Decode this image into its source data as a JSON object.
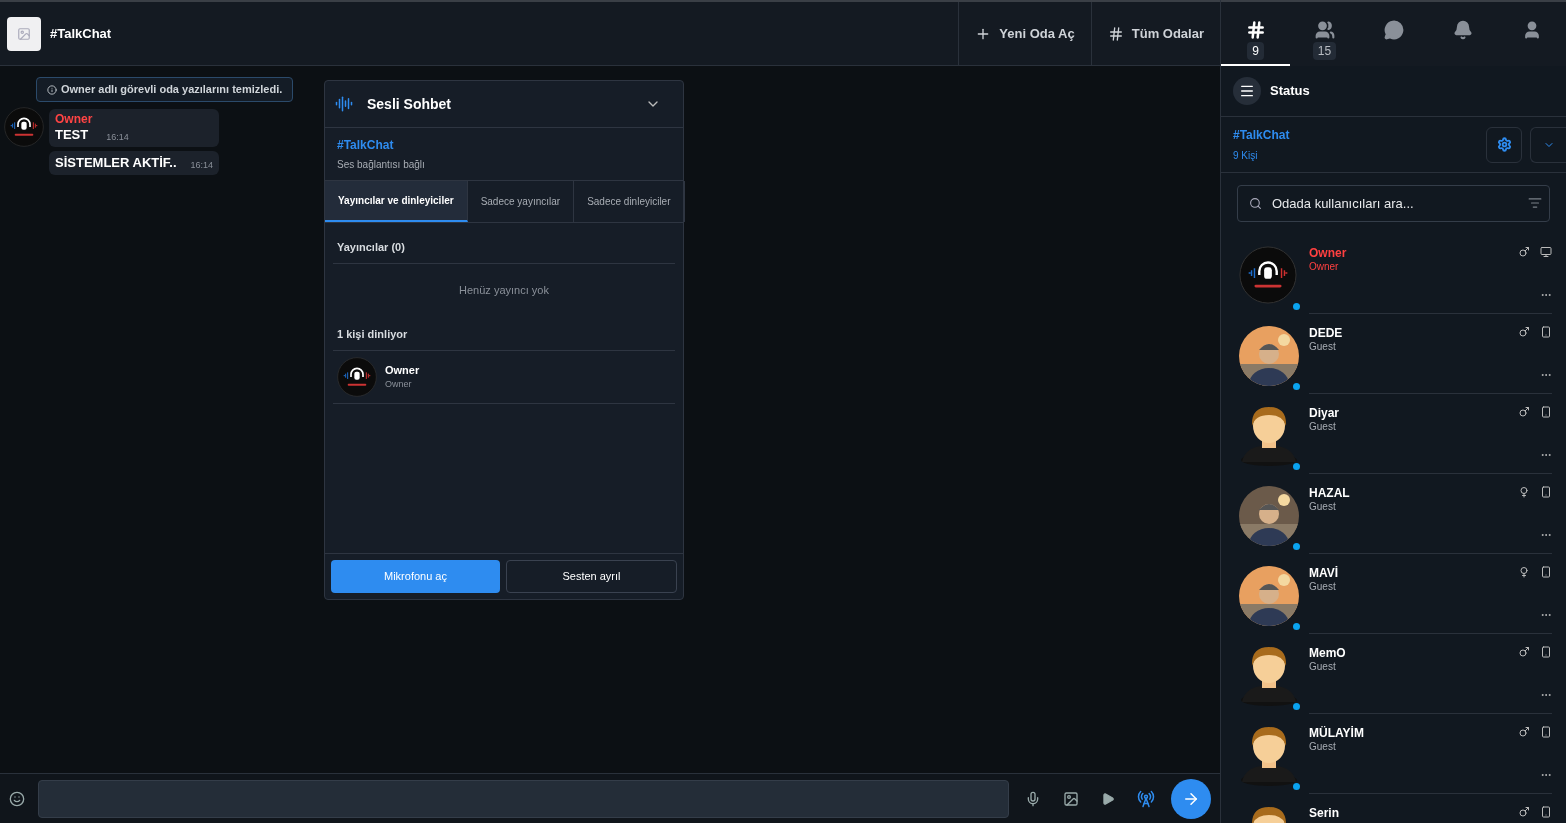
{
  "header": {
    "room_title": "#TalkChat",
    "actions": [
      {
        "kind": "plus",
        "label": "Yeni Oda Aç"
      },
      {
        "kind": "hash",
        "label": "Tüm Odalar"
      }
    ]
  },
  "chat": {
    "notice": "Owner adlı görevli oda yazılarını temizledi.",
    "messages": [
      {
        "sender": "Owner",
        "text": "TEST",
        "time": "16:14"
      },
      {
        "text": "SİSTEMLER AKTİF..",
        "time": "16:14"
      }
    ]
  },
  "voice_panel": {
    "title": "Sesli Sohbet",
    "room": "#TalkChat",
    "status": "Ses bağlantısı bağlı",
    "tabs": [
      {
        "label": "Yayıncılar ve dinleyiciler",
        "selected": true
      },
      {
        "label": "Sadece yayıncılar",
        "selected": false
      },
      {
        "label": "Sadece dinleyiciler",
        "selected": false
      }
    ],
    "broadcasters_heading": "Yayıncılar (0)",
    "broadcasters_empty": "Henüz yayıncı yok",
    "listeners_heading": "1 kişi dinliyor",
    "listeners": [
      {
        "name": "Owner",
        "role": "Owner"
      }
    ],
    "buttons": [
      {
        "kind": "primary",
        "label": "Mikrofonu aç"
      },
      {
        "kind": "secondary",
        "label": "Sesten ayrıl"
      }
    ]
  },
  "sidebar": {
    "tabs": [
      {
        "kind": "hash",
        "count": "9",
        "selected": true
      },
      {
        "kind": "users",
        "count": "15",
        "selected": false
      },
      {
        "kind": "chat",
        "selected": false
      },
      {
        "kind": "bell",
        "selected": false
      },
      {
        "kind": "user",
        "selected": false
      }
    ],
    "status_label": "Status",
    "room": "#TalkChat",
    "room_count": "9 Kişi",
    "search": {
      "placeholder": "Odada kullanıcıları ara..."
    },
    "users": [
      {
        "name": "Owner",
        "role": "Owner",
        "owner": true,
        "online": true,
        "more": true,
        "avatar": {
          "kind": "logo"
        },
        "icons": [
          {
            "kind": "male"
          },
          {
            "kind": "desktop"
          }
        ]
      },
      {
        "name": "DEDE",
        "role": "Guest",
        "owner": false,
        "online": true,
        "more": true,
        "avatar": {
          "kind": "picture"
        },
        "icons": [
          {
            "kind": "male"
          },
          {
            "kind": "mobile"
          }
        ]
      },
      {
        "name": "Diyar",
        "role": "Guest",
        "owner": false,
        "online": true,
        "more": true,
        "avatar": {
          "kind": "silhouette"
        },
        "icons": [
          {
            "kind": "male"
          },
          {
            "kind": "mobile"
          }
        ]
      },
      {
        "name": "HAZAL",
        "role": "Guest",
        "owner": false,
        "online": true,
        "more": true,
        "avatar": {
          "kind": "picture"
        },
        "icons": [
          {
            "kind": "female"
          },
          {
            "kind": "mobile"
          }
        ]
      },
      {
        "name": "MAVİ",
        "role": "Guest",
        "owner": false,
        "online": true,
        "more": true,
        "avatar": {
          "kind": "picture"
        },
        "icons": [
          {
            "kind": "female"
          },
          {
            "kind": "mobile"
          }
        ]
      },
      {
        "name": "MemO",
        "role": "Guest",
        "owner": false,
        "online": true,
        "more": true,
        "avatar": {
          "kind": "silhouette"
        },
        "icons": [
          {
            "kind": "male"
          },
          {
            "kind": "mobile"
          }
        ]
      },
      {
        "name": "MÜLAYİM",
        "role": "Guest",
        "owner": false,
        "online": true,
        "more": true,
        "avatar": {
          "kind": "silhouette"
        },
        "icons": [
          {
            "kind": "male"
          },
          {
            "kind": "mobile"
          }
        ]
      },
      {
        "name": "Serin",
        "owner": false,
        "avatar": {
          "kind": "silhouette"
        },
        "icons": [
          {
            "kind": "male"
          },
          {
            "kind": "mobile"
          }
        ]
      }
    ]
  }
}
